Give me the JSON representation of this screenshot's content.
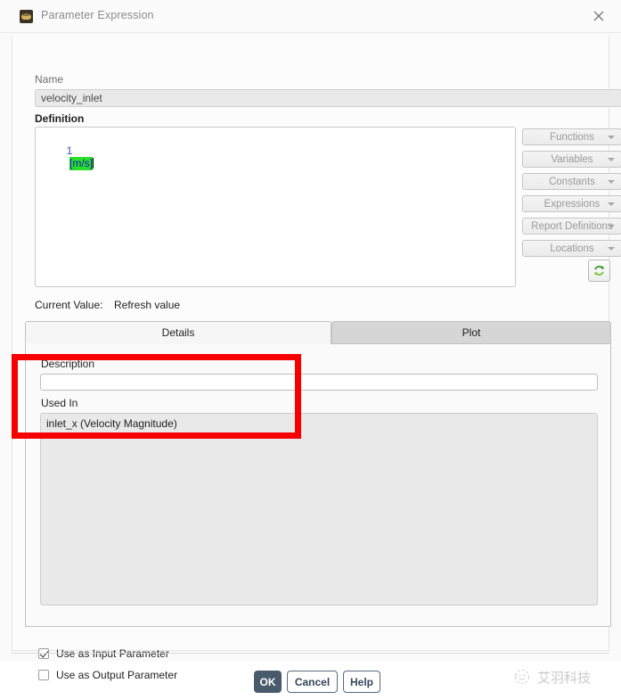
{
  "window": {
    "title": "Parameter Expression",
    "icon": "fluent-app-icon",
    "close_icon": "close-icon"
  },
  "form": {
    "name_label": "Name",
    "name_value": "velocity_inlet",
    "definition_label": "Definition",
    "definition_line_number": "1",
    "definition_value": "[m/s]"
  },
  "dropdowns": [
    {
      "label": "Functions"
    },
    {
      "label": "Variables"
    },
    {
      "label": "Constants"
    },
    {
      "label": "Expressions"
    },
    {
      "label": "Report Definitions"
    },
    {
      "label": "Locations"
    }
  ],
  "current_value": {
    "label": "Current Value:",
    "text": "Refresh value",
    "refresh_icon": "refresh-icon"
  },
  "tabs": [
    {
      "label": "Details",
      "active": true
    },
    {
      "label": "Plot",
      "active": false
    }
  ],
  "details": {
    "description_label": "Description",
    "description_value": "",
    "description_placeholder": "",
    "used_in_label": "Used In",
    "used_in_items": [
      "inlet_x (Velocity Magnitude)"
    ]
  },
  "checkboxes": [
    {
      "label": "Use as Input Parameter",
      "checked": true
    },
    {
      "label": "Use as Output Parameter",
      "checked": false
    }
  ],
  "footer_buttons": {
    "ok": "OK",
    "cancel": "Cancel",
    "help": "Help"
  },
  "watermark": {
    "text": "艾羽科技",
    "logo": "circle-face-logo"
  },
  "annotation": {
    "color": "#f60000",
    "target": "used-in-section"
  },
  "colors": {
    "accent_ok": "#4a5a6d",
    "highlight_token_bg": "#29e029",
    "token_text": "#1414c8",
    "annotation_red": "#f60000"
  }
}
